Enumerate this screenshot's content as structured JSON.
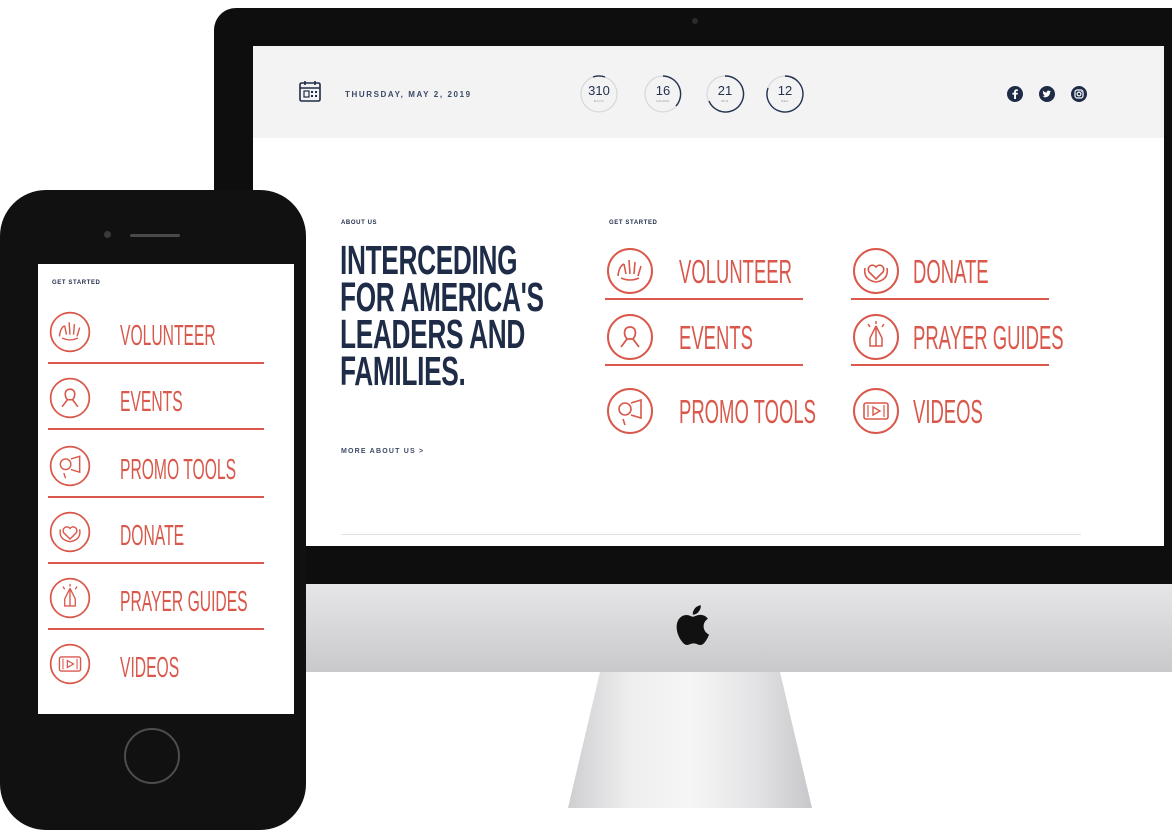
{
  "desktop": {
    "header": {
      "date": "THURSDAY, MAY 2, 2019",
      "countdown": [
        {
          "value": "310",
          "unit": "DAYS"
        },
        {
          "value": "16",
          "unit": "HOURS"
        },
        {
          "value": "21",
          "unit": "MIN"
        },
        {
          "value": "12",
          "unit": "SEC"
        }
      ],
      "social": [
        "facebook-icon",
        "twitter-icon",
        "instagram-icon"
      ]
    },
    "about": {
      "label": "ABOUT US",
      "headline": [
        "INTERCEDING",
        "FOR AMERICA'S",
        "LEADERS AND",
        "FAMILIES."
      ],
      "link": "MORE ABOUT US >"
    },
    "get_started": {
      "label": "GET STARTED",
      "items": [
        {
          "label": "VOLUNTEER",
          "icon": "hands-icon"
        },
        {
          "label": "EVENTS",
          "icon": "ribbon-icon"
        },
        {
          "label": "PROMO TOOLS",
          "icon": "megaphone-icon"
        },
        {
          "label": "DONATE",
          "icon": "heart-hands-icon"
        },
        {
          "label": "PRAYER GUIDES",
          "icon": "praying-hands-icon"
        },
        {
          "label": "VIDEOS",
          "icon": "video-icon"
        }
      ]
    }
  },
  "mobile": {
    "label": "GET STARTED",
    "items": [
      {
        "label": "VOLUNTEER",
        "icon": "hands-icon"
      },
      {
        "label": "EVENTS",
        "icon": "ribbon-icon"
      },
      {
        "label": "PROMO TOOLS",
        "icon": "megaphone-icon"
      },
      {
        "label": "DONATE",
        "icon": "heart-hands-icon"
      },
      {
        "label": "PRAYER GUIDES",
        "icon": "praying-hands-icon"
      },
      {
        "label": "VIDEOS",
        "icon": "video-icon"
      }
    ]
  },
  "colors": {
    "accent": "#d9584b",
    "navy": "#1f2c48",
    "header_bg": "#f3f3f4"
  }
}
